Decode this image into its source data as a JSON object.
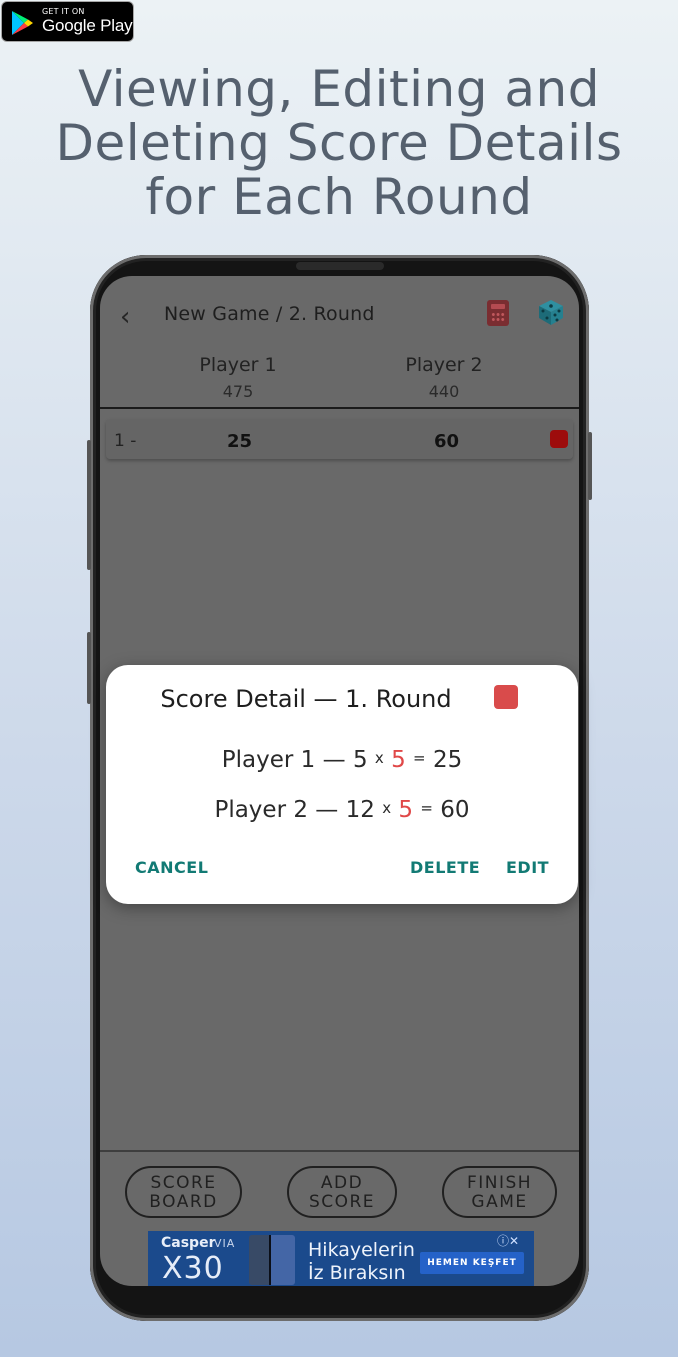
{
  "badge": {
    "small_text": "GET IT ON",
    "big_text": "Google Play"
  },
  "headline": [
    "Viewing, Editing and",
    "Deleting Score Details",
    "for Each Round"
  ],
  "app": {
    "back_glyph": "‹",
    "breadcrumb": "New Game  /  2. Round",
    "icons": {
      "calculator": "calculator-icon",
      "dice": "dice-icon"
    },
    "players": [
      {
        "name": "Player 1",
        "total": "475"
      },
      {
        "name": "Player 2",
        "total": "440"
      }
    ],
    "rounds": [
      {
        "index": "1 -",
        "p1": "25",
        "p2": "60",
        "color": "#9d0c0c"
      }
    ],
    "buttons": {
      "score_board": [
        "SCORE",
        "BOARD"
      ],
      "add_score": [
        "ADD",
        "SCORE"
      ],
      "finish_game": [
        "FINISH",
        "GAME"
      ]
    },
    "ad": {
      "brand": "Casper",
      "via": "VIA",
      "model": "X30",
      "headline_1": "Hikayelerin",
      "headline_2": "İz Bıraksın",
      "cta": "HEMEN KEŞFET",
      "ad_icons": "ⓘ✕"
    }
  },
  "dialog": {
    "title": "Score Detail — 1. Round",
    "color": "#d94b4b",
    "lines": [
      {
        "player": "Player 1",
        "sep": " — ",
        "a": "5",
        "mul": "x",
        "b": "5",
        "eq": "=",
        "result": "25"
      },
      {
        "player": "Player 2",
        "sep": " — ",
        "a": "12",
        "mul": "x",
        "b": "5",
        "eq": "=",
        "result": "60"
      }
    ],
    "cancel": "CANCEL",
    "delete": "DELETE",
    "edit": "EDIT"
  },
  "colors": {
    "accent_teal": "#127a74",
    "highlight_red": "#e04848",
    "overlay_gray": "#696969"
  }
}
